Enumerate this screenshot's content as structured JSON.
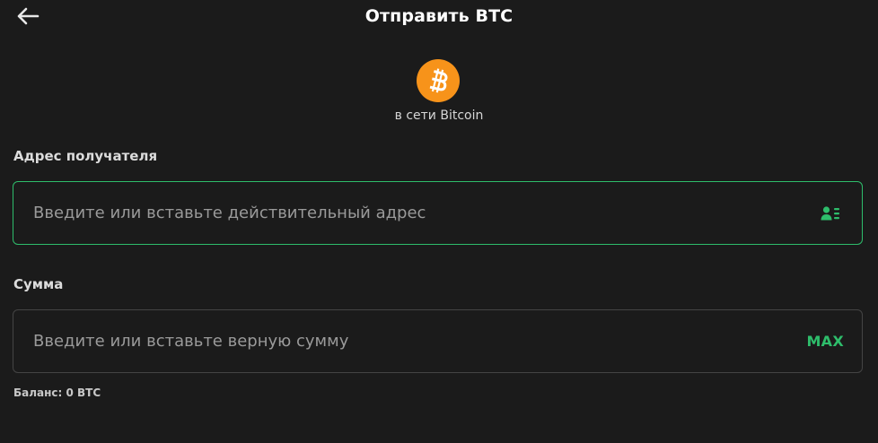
{
  "header": {
    "title": "Отправить BTC",
    "back_icon": "arrow-left-icon"
  },
  "coin": {
    "icon": "bitcoin-icon",
    "color": "#f7931a",
    "network_label": "в сети Bitcoin"
  },
  "address": {
    "label": "Адрес получателя",
    "placeholder": "Введите или вставьте действительный адрес",
    "value": "",
    "contact_icon": "address-book-icon",
    "border_color": "#2ebd6b"
  },
  "amount": {
    "label": "Сумма",
    "placeholder": "Введите или вставьте верную сумму",
    "value": "",
    "max_label": "MAX"
  },
  "balance": {
    "text": "Баланс: 0 BTC"
  },
  "colors": {
    "background": "#1b1b1b",
    "accent": "#2ebd6b",
    "bitcoin": "#f7931a"
  }
}
